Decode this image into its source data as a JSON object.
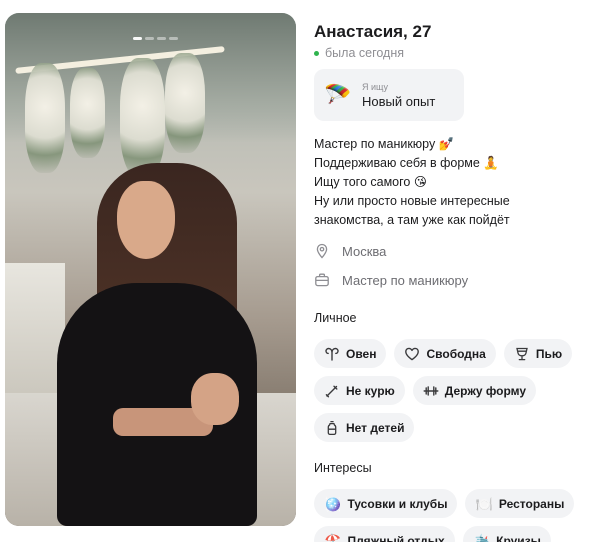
{
  "profile": {
    "name": "Анастасия, 27",
    "status": "была сегодня",
    "status_color": "#2fb44e"
  },
  "looking_for": {
    "label": "Я ищу",
    "value": "Новый опыт",
    "icon": "parachute-icon"
  },
  "bio": [
    "Мастер по маникюру 💅",
    "Поддерживаю себя в форме 🧘",
    "Ищу того самого 😘",
    "Ну или просто новые интересные",
    "знакомства, а там уже как пойдёт"
  ],
  "location": {
    "text": "Москва",
    "icon": "location-pin-icon"
  },
  "job": {
    "text": "Мастер по маникюру",
    "icon": "briefcase-icon"
  },
  "personal": {
    "title": "Личное",
    "chips": [
      {
        "label": "Овен",
        "icon": "aries-icon"
      },
      {
        "label": "Свободна",
        "icon": "heart-icon"
      },
      {
        "label": "Пью",
        "icon": "glass-icon"
      },
      {
        "label": "Не курю",
        "icon": "no-smoking-icon"
      },
      {
        "label": "Держу форму",
        "icon": "dumbbell-icon"
      },
      {
        "label": "Нет детей",
        "icon": "baby-bottle-icon"
      }
    ]
  },
  "interests": {
    "title": "Интересы",
    "chips": [
      {
        "label": "Тусовки и клубы",
        "emoji": "🪩"
      },
      {
        "label": "Рестораны",
        "emoji": "🍽️"
      },
      {
        "label": "Пляжный отдых",
        "emoji": "🏖️"
      },
      {
        "label": "Круизы",
        "emoji": "🛳️"
      }
    ]
  },
  "photo": {
    "count": 4,
    "active": 0
  }
}
